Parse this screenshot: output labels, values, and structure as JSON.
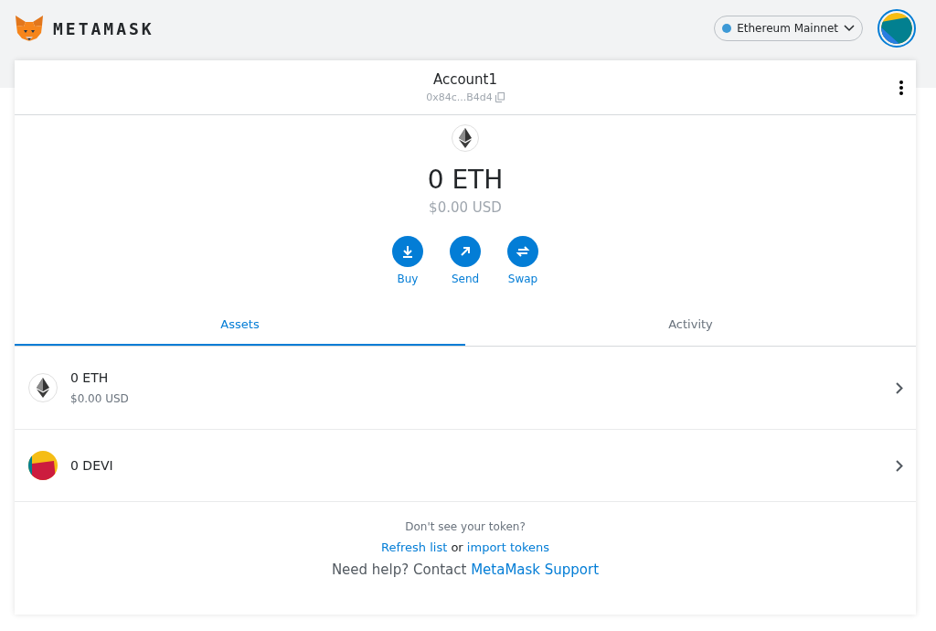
{
  "header": {
    "logo_text": "METAMASK",
    "network": {
      "label": "Ethereum Mainnet"
    }
  },
  "account": {
    "name": "Account1",
    "address": "0x84c...B4d4"
  },
  "balance": {
    "amount": "0 ETH",
    "fiat": "$0.00 USD"
  },
  "actions": [
    {
      "label": "Buy",
      "kind": "buy"
    },
    {
      "label": "Send",
      "kind": "send"
    },
    {
      "label": "Swap",
      "kind": "swap"
    }
  ],
  "tabs": [
    {
      "label": "Assets",
      "selected": true
    },
    {
      "label": "Activity",
      "selected": false
    }
  ],
  "assets": [
    {
      "kind": "eth",
      "amount": "0 ETH",
      "fiat": "$0.00 USD"
    },
    {
      "kind": "devi",
      "amount": "0 DEVI"
    }
  ],
  "footer": {
    "question": "Don't see your token?",
    "refresh_link": "Refresh list",
    "or_text": "or",
    "import_link": "import tokens",
    "help_text": "Need help? Contact",
    "support_link": "MetaMask Support"
  }
}
